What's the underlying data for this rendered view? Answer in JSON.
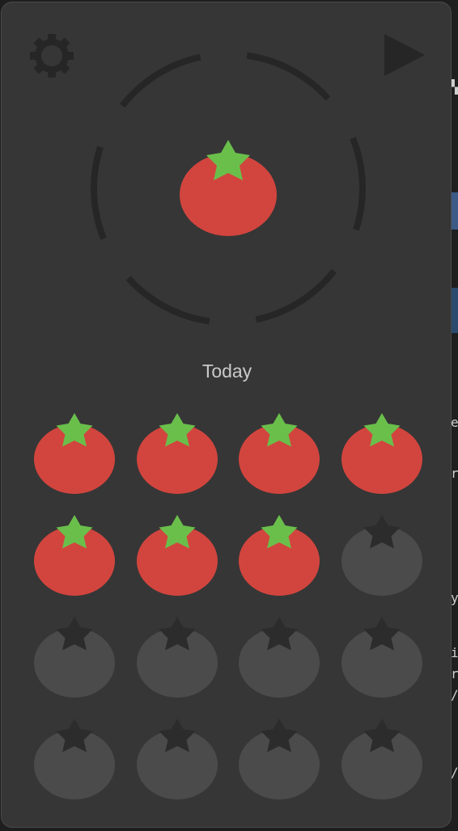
{
  "app": {
    "today_label": "Today",
    "settings_icon": "gear-icon",
    "play_icon": "play-icon",
    "timer_icon": "tomato-icon"
  },
  "pomodoros": {
    "goal": 16,
    "completed": 7
  },
  "colors": {
    "tomato_red": "#d2453e",
    "leaf_green": "#6abf4b",
    "inactive_body": "#4b4b4b",
    "inactive_leaf": "#2c2c2c",
    "panel_bg": "#363636",
    "ring": "#262626",
    "icon": "#262626"
  }
}
